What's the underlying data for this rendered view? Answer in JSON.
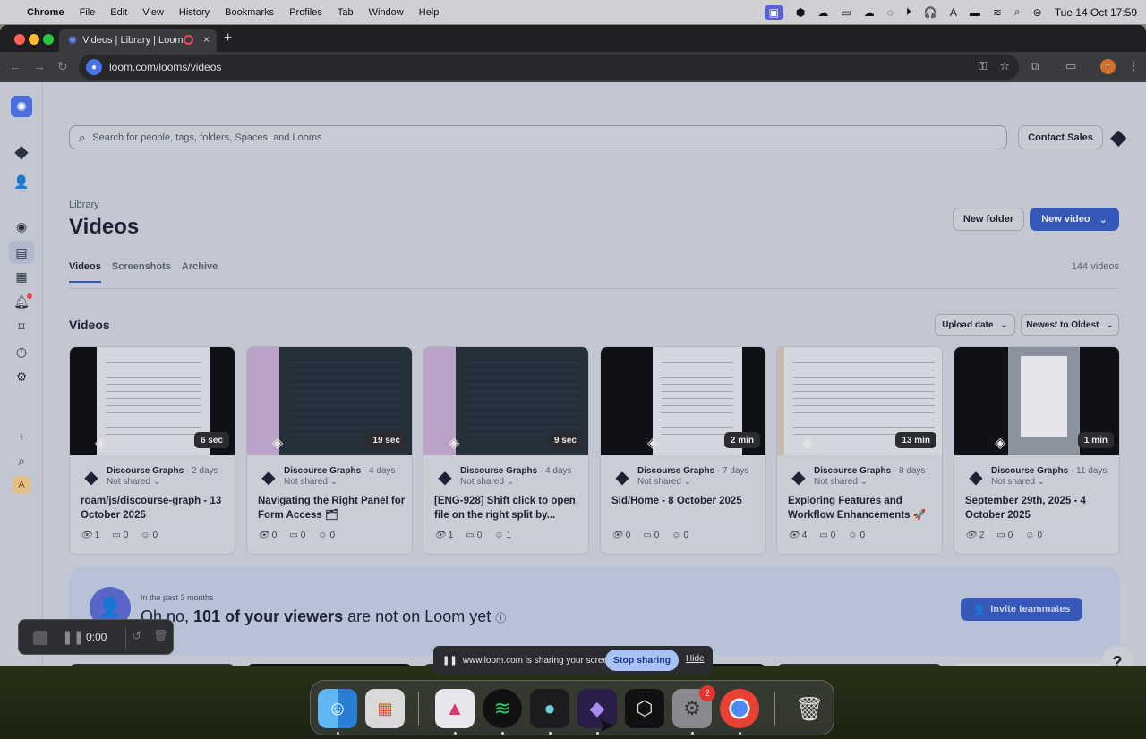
{
  "menubar": {
    "app": "Chrome",
    "items": [
      "File",
      "Edit",
      "View",
      "History",
      "Bookmarks",
      "Profiles",
      "Tab",
      "Window",
      "Help"
    ],
    "datetime": "Tue 14 Oct  17:59"
  },
  "browser": {
    "tab_title": "Videos | Library | Loom",
    "url": "loom.com/looms/videos",
    "profile_initial": "T"
  },
  "page": {
    "search_placeholder": "Search for people, tags, folders, Spaces, and Looms",
    "contact_sales": "Contact Sales",
    "breadcrumb": "Library",
    "title": "Videos",
    "new_folder": "New folder",
    "new_video": "New video",
    "tabs": [
      "Videos",
      "Screenshots",
      "Archive"
    ],
    "video_count": "144 videos",
    "section_title": "Videos",
    "sort_field": "Upload date",
    "sort_order": "Newest to Oldest"
  },
  "sidebar": {
    "workspace_initial": "A"
  },
  "cards": [
    {
      "duration": "6 sec",
      "author": "Discourse Graphs",
      "age": "· 2 days",
      "shared": "Not shared",
      "title": "roam/js/discourse-graph - 13 October 2025",
      "views": "1",
      "comments": "0",
      "reactions": "0"
    },
    {
      "duration": "19 sec",
      "author": "Discourse Graphs",
      "age": "· 4 days",
      "shared": "Not shared",
      "title": "Navigating the Right Panel for Form Access 🗂",
      "views": "0",
      "comments": "0",
      "reactions": "0"
    },
    {
      "duration": "9 sec",
      "author": "Discourse Graphs",
      "age": "· 4 days",
      "shared": "Not shared",
      "title": "[ENG-928] Shift click to open file on the right split by...",
      "views": "1",
      "comments": "0",
      "reactions": "1"
    },
    {
      "duration": "2 min",
      "author": "Discourse Graphs",
      "age": "· 7 days",
      "shared": "Not shared",
      "title": "Sid/Home - 8 October 2025",
      "views": "0",
      "comments": "0",
      "reactions": "0"
    },
    {
      "duration": "13 min",
      "author": "Discourse Graphs",
      "age": "· 8 days",
      "shared": "Not shared",
      "title": "Exploring Features and Workflow Enhancements 🚀",
      "views": "4",
      "comments": "0",
      "reactions": "0"
    },
    {
      "duration": "1 min",
      "author": "Discourse Graphs",
      "age": "· 11 days",
      "shared": "Not shared",
      "title": "September 29th, 2025 - 4 October 2025",
      "views": "2",
      "comments": "0",
      "reactions": "0"
    }
  ],
  "banner": {
    "small": "In the past 3 months",
    "lead": "Oh no, ",
    "bold": "101 of your viewers",
    "rest": " are not on Loom yet",
    "invite": "Invite teammates"
  },
  "recorder": {
    "time": "0:00"
  },
  "sharing": {
    "message": "www.loom.com is sharing your screen.",
    "stop": "Stop sharing",
    "hide": "Hide"
  },
  "dock": {
    "settings_badge": "2",
    "apps": [
      "finder",
      "launchpad",
      "affinity",
      "spotify",
      "slack-like",
      "obsidian",
      "cursor",
      "system-settings",
      "chrome",
      "trash"
    ]
  },
  "colors": {
    "accent": "#3658b8",
    "page_bg": "#c3c7d1"
  }
}
